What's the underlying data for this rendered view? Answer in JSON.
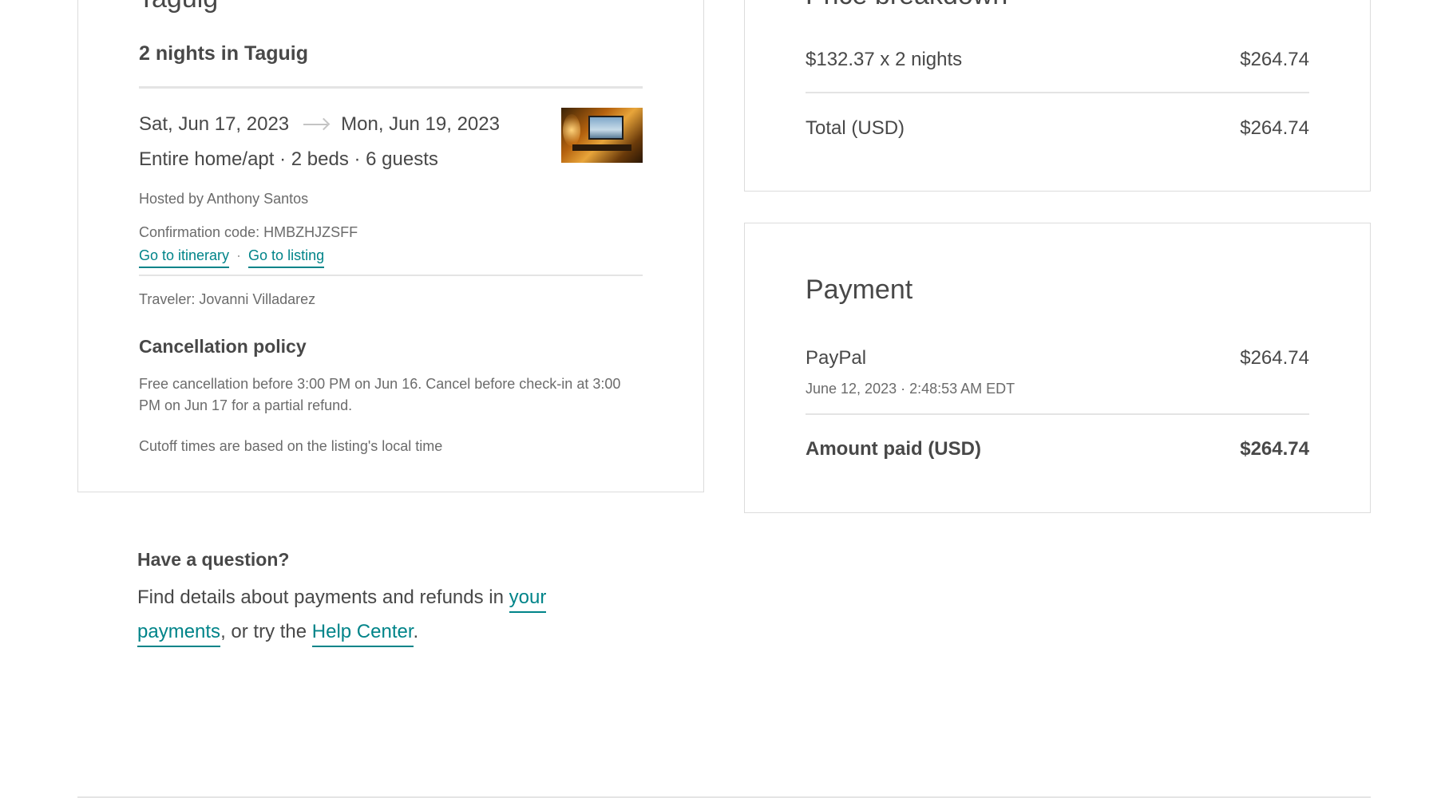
{
  "reservation": {
    "heading_cut": "Taguig",
    "nights_title": "2 nights in Taguig",
    "check_in": "Sat, Jun 17, 2023",
    "check_out": "Mon, Jun 19, 2023",
    "home_details": "Entire home/apt · 2 beds · 6 guests",
    "hosted_by": "Hosted by Anthony Santos",
    "confirmation": "Confirmation code: HMBZHJZSFF",
    "itinerary_link": "Go to itinerary",
    "link_separator": "·",
    "listing_link": "Go to listing",
    "traveler": "Traveler: Jovanni Villadarez",
    "cancellation_title": "Cancellation policy",
    "cancellation_text": "Free cancellation before 3:00 PM on Jun 16. Cancel before check-in at 3:00 PM on Jun 17 for a partial refund.",
    "cutoff_note": "Cutoff times are based on the listing's local time"
  },
  "price": {
    "heading_cut": "Price breakdown",
    "rate_label": "$132.37 x 2 nights",
    "rate_amount": "$264.74",
    "total_label": "Total (USD)",
    "total_amount": "$264.74"
  },
  "payment": {
    "title": "Payment",
    "method": "PayPal",
    "method_amount": "$264.74",
    "date": "June 12, 2023 · 2:48:53 AM EDT",
    "paid_label": "Amount paid (USD)",
    "paid_amount": "$264.74"
  },
  "question": {
    "title": "Have a question?",
    "text_before": "Find details about payments and refunds in ",
    "payments_link": "your payments",
    "text_middle": ", or try the ",
    "help_link": "Help Center",
    "text_after": "."
  },
  "colors": {
    "link": "#008489",
    "text": "#484848",
    "muted": "#6b6b6b",
    "border": "#dcdcdc"
  }
}
